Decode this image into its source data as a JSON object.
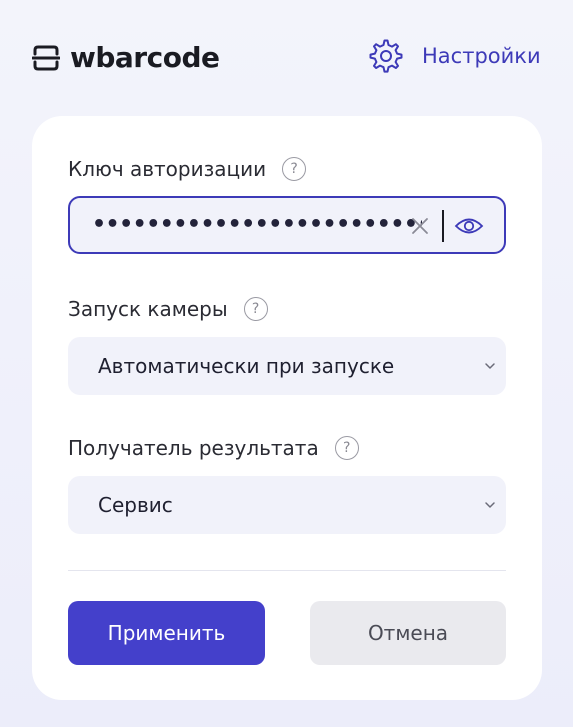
{
  "header": {
    "logo_text": "wbarcode",
    "logo_icon": "barcode-scan-icon",
    "settings_icon": "gear-icon",
    "settings_label": "Настройки"
  },
  "form": {
    "auth_key": {
      "label": "Ключ авторизации",
      "help_glyph": "?",
      "masked_value": "•••••••••••••••••••••••••••••••••••••",
      "clear_icon": "clear-icon",
      "visibility_icon": "eye-icon"
    },
    "camera_launch": {
      "label": "Запуск камеры",
      "help_glyph": "?",
      "selected": "Автоматически при запуске"
    },
    "result_receiver": {
      "label": "Получатель результата",
      "help_glyph": "?",
      "selected": "Сервис"
    }
  },
  "actions": {
    "apply_label": "Применить",
    "cancel_label": "Отмена"
  },
  "colors": {
    "accent": "#4440cb",
    "link": "#3d3ab8",
    "background": "#f1f2fb",
    "card": "#ffffff",
    "field_bg": "#f1f2fa",
    "cancel_bg": "#eaeaee"
  }
}
